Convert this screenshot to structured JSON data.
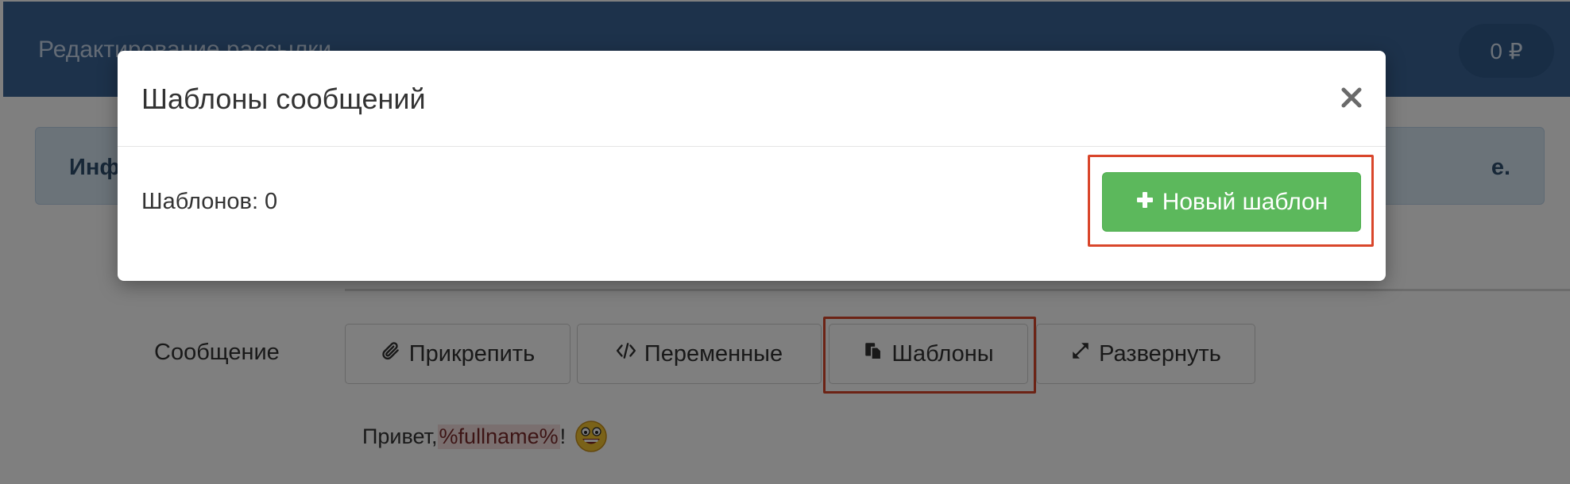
{
  "page": {
    "title": "Редактирование рассылки",
    "balance": "0 ₽",
    "info_start": "Инф",
    "info_end": "е."
  },
  "editor": {
    "message_label": "Сообщение",
    "toolbar": {
      "attach_label": "Прикрепить",
      "variables_label": "Переменные",
      "templates_label": "Шаблоны",
      "expand_label": "Развернуть"
    },
    "message_text_prefix": "Привет, ",
    "message_variable": "%fullname%",
    "message_text_suffix": "!"
  },
  "modal": {
    "title": "Шаблоны сообщений",
    "close_symbol": "×",
    "count_label": "Шаблонов: 0",
    "new_template_label": "Новый шаблон"
  },
  "colors": {
    "header_bg": "#3a6496",
    "primary_success": "#5cb85c",
    "highlight_border": "#d9462b",
    "info_bg": "#d6e6f3"
  },
  "icons": {
    "attach": "paperclip-icon",
    "variables": "code-icon",
    "templates": "copy-icon",
    "expand": "expand-icon",
    "new_template": "plus-icon",
    "close": "close-icon",
    "emoji": "grinning-face-emoji"
  }
}
